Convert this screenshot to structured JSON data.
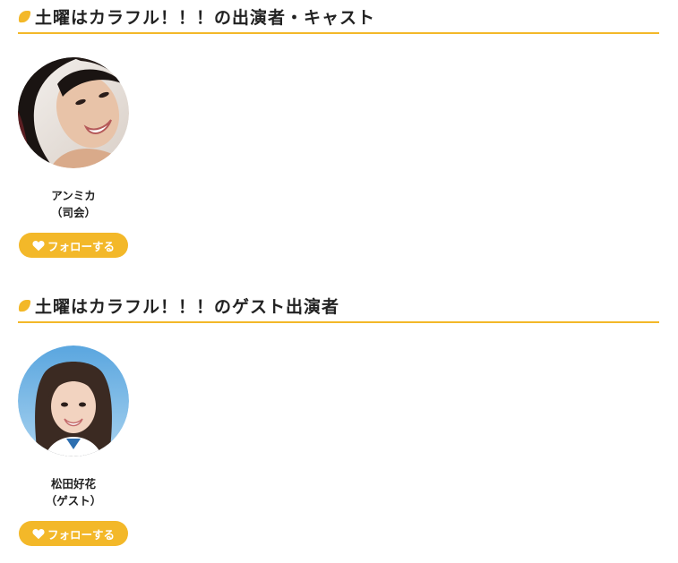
{
  "sections": [
    {
      "heading": "土曜はカラフル！！！の出演者・キャスト",
      "cast": [
        {
          "name": "アンミカ",
          "role": "（司会）",
          "follow_label": "フォローする"
        }
      ]
    },
    {
      "heading": "土曜はカラフル！！！のゲスト出演者",
      "cast": [
        {
          "name": "松田好花",
          "role": "（ゲスト）",
          "follow_label": "フォローする"
        }
      ]
    }
  ],
  "colors": {
    "accent": "#f3b829",
    "text": "#222222",
    "button_text": "#ffffff"
  },
  "icons": {
    "heading": "leaf-icon",
    "follow": "heart-icon"
  }
}
